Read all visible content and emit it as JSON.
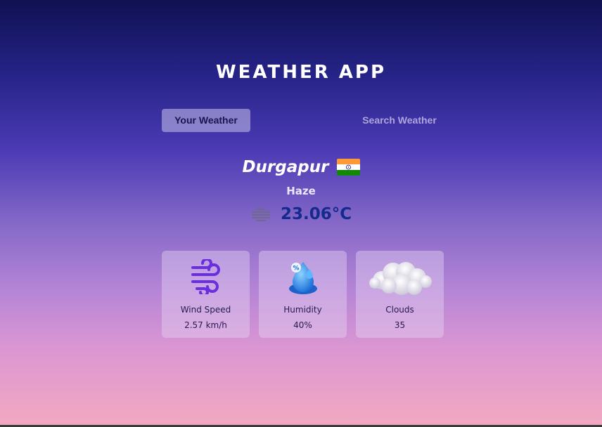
{
  "app": {
    "title": "WEATHER APP"
  },
  "tabs": [
    {
      "label": "Your Weather",
      "active": true
    },
    {
      "label": "Search Weather",
      "active": false
    }
  ],
  "location": {
    "city": "Durgapur",
    "country_flag": "india-flag-icon"
  },
  "weather": {
    "condition": "Haze",
    "condition_icon": "haze-icon",
    "temperature": "23.06°C"
  },
  "stats": [
    {
      "label": "Wind Speed",
      "value": "2.57 km/h",
      "icon": "wind-icon"
    },
    {
      "label": "Humidity",
      "value": "40%",
      "icon": "humidity-icon"
    },
    {
      "label": "Clouds",
      "value": "35",
      "icon": "cloud-icon"
    }
  ],
  "colors": {
    "temperature": "#152a8c",
    "active_tab_bg": "#b8b2e0",
    "wind_icon": "#6a2ee0",
    "humidity_icon": "#2a8fe6"
  }
}
